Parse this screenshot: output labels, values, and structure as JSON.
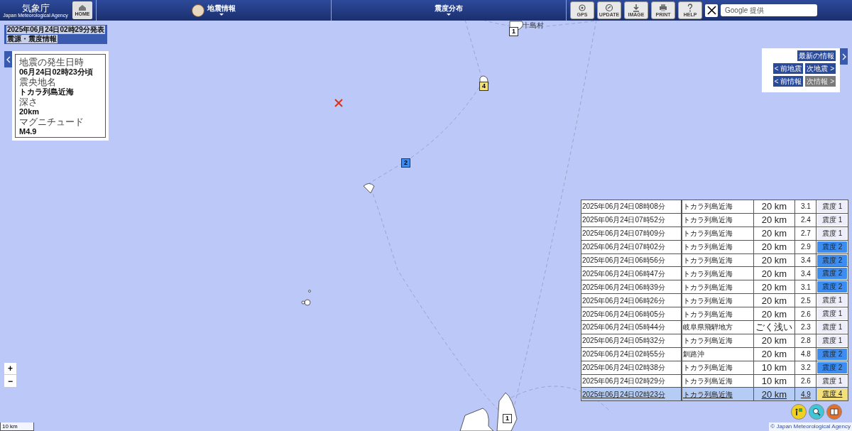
{
  "header": {
    "logo": "気象庁",
    "logo_sub": "Japan Meteorological Agency",
    "home": "HOME",
    "menus": [
      {
        "label": "地震情報",
        "icon": true
      },
      {
        "label": "震度分布",
        "icon": false
      }
    ],
    "tools": [
      "GPS",
      "UPDATE",
      "IMAGE",
      "PRINT",
      "HELP"
    ],
    "search": {
      "placeholder": "Google 提供"
    }
  },
  "bulletin": {
    "issued": "2025年06月24日02時29分発表",
    "title": "震源・震度情報"
  },
  "info": [
    {
      "label": "地震の発生日時",
      "value": "06月24日02時23分頃"
    },
    {
      "label": "震央地名",
      "value": "トカラ列島近海"
    },
    {
      "label": "深さ",
      "value": "20km"
    },
    {
      "label": "マグニチュード",
      "value": "M4.9"
    }
  ],
  "nav": {
    "latest": "最新の情報",
    "buttons": [
      {
        "label": "< 前地震",
        "disabled": false
      },
      {
        "label": "次地震 >",
        "disabled": false
      },
      {
        "label": "< 前情報",
        "disabled": false
      },
      {
        "label": "次情報 >",
        "disabled": true
      }
    ]
  },
  "map": {
    "markers": [
      {
        "label": "1",
        "color": "#ffffff"
      },
      {
        "label": "4",
        "color": "#f3e07a"
      },
      {
        "label": "2",
        "color": "#3d8cf0"
      },
      {
        "label": "1",
        "color": "#ffffff"
      }
    ],
    "place": "十島村",
    "scale": "10 km",
    "zoom_in": "+",
    "zoom_out": "−",
    "copyright": "© Japan Meteorological Agency"
  },
  "table": {
    "rows": [
      {
        "time": "2025年06月24日08時08分",
        "place": "トカラ列島近海",
        "depth": "20 km",
        "mag": "3.1",
        "intensity": "震度 1",
        "color": "#eeeefa",
        "selected": false
      },
      {
        "time": "2025年06月24日07時52分",
        "place": "トカラ列島近海",
        "depth": "20 km",
        "mag": "2.4",
        "intensity": "震度 1",
        "color": "#eeeefa",
        "selected": false
      },
      {
        "time": "2025年06月24日07時09分",
        "place": "トカラ列島近海",
        "depth": "20 km",
        "mag": "2.7",
        "intensity": "震度 1",
        "color": "#eeeefa",
        "selected": false
      },
      {
        "time": "2025年06月24日07時02分",
        "place": "トカラ列島近海",
        "depth": "20 km",
        "mag": "2.9",
        "intensity": "震度 2",
        "color": "#3d8cf0",
        "selected": false
      },
      {
        "time": "2025年06月24日06時56分",
        "place": "トカラ列島近海",
        "depth": "20 km",
        "mag": "3.4",
        "intensity": "震度 2",
        "color": "#3d8cf0",
        "selected": false
      },
      {
        "time": "2025年06月24日06時47分",
        "place": "トカラ列島近海",
        "depth": "20 km",
        "mag": "3.4",
        "intensity": "震度 2",
        "color": "#3d8cf0",
        "selected": false
      },
      {
        "time": "2025年06月24日06時39分",
        "place": "トカラ列島近海",
        "depth": "20 km",
        "mag": "3.1",
        "intensity": "震度 2",
        "color": "#3d8cf0",
        "selected": false
      },
      {
        "time": "2025年06月24日06時26分",
        "place": "トカラ列島近海",
        "depth": "20 km",
        "mag": "2.5",
        "intensity": "震度 1",
        "color": "#eeeefa",
        "selected": false
      },
      {
        "time": "2025年06月24日06時05分",
        "place": "トカラ列島近海",
        "depth": "20 km",
        "mag": "2.6",
        "intensity": "震度 1",
        "color": "#eeeefa",
        "selected": false
      },
      {
        "time": "2025年06月24日05時44分",
        "place": "岐阜県飛騨地方",
        "depth": "ごく浅い",
        "mag": "2.3",
        "intensity": "震度 1",
        "color": "#eeeefa",
        "selected": false
      },
      {
        "time": "2025年06月24日05時32分",
        "place": "トカラ列島近海",
        "depth": "20 km",
        "mag": "2.8",
        "intensity": "震度 1",
        "color": "#eeeefa",
        "selected": false
      },
      {
        "time": "2025年06月24日02時55分",
        "place": "釧路沖",
        "depth": "20 km",
        "mag": "4.8",
        "intensity": "震度 2",
        "color": "#3d8cf0",
        "selected": false
      },
      {
        "time": "2025年06月24日02時38分",
        "place": "トカラ列島近海",
        "depth": "10 km",
        "mag": "3.2",
        "intensity": "震度 2",
        "color": "#3d8cf0",
        "selected": false
      },
      {
        "time": "2025年06月24日02時29分",
        "place": "トカラ列島近海",
        "depth": "10 km",
        "mag": "2.6",
        "intensity": "震度 1",
        "color": "#eeeefa",
        "selected": false
      },
      {
        "time": "2025年06月24日02時23分",
        "place": "トカラ列島近海",
        "depth": "20 km",
        "mag": "4.9",
        "intensity": "震度 4",
        "color": "#f3e07a",
        "selected": true
      }
    ]
  }
}
